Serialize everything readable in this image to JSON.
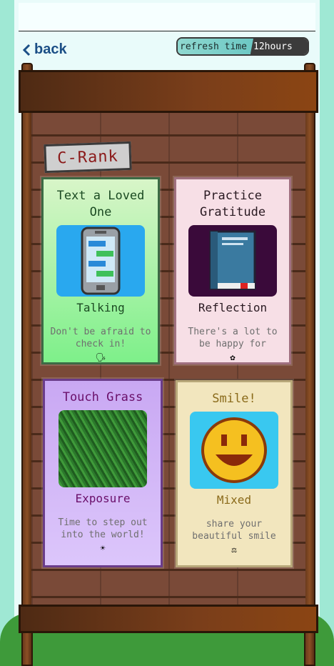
{
  "header": {
    "back_label": "back",
    "refresh_label": "refresh time",
    "refresh_value": "12hours"
  },
  "rank_label": "C-Rank",
  "cards": [
    {
      "title": "Text a Loved One",
      "category": "Talking",
      "description": "Don't be afraid to check in!",
      "icon": "speaking-icon",
      "art": "phone-chat-icon"
    },
    {
      "title": "Practice Gratitude",
      "category": "Reflection",
      "description": "There's a lot to be happy for",
      "icon": "flower-icon",
      "art": "book-icon"
    },
    {
      "title": "Touch Grass",
      "category": "Exposure",
      "description": "Time to step out into the world!",
      "icon": "sun-icon",
      "art": "grass-image"
    },
    {
      "title": "Smile!",
      "category": "Mixed",
      "description": "share your beautiful smile",
      "icon": "scales-icon",
      "art": "smiley-face-icon"
    }
  ],
  "colors": {
    "accent": "#1b4f86",
    "rank_text": "#8b1a1a",
    "grass": "#3e9a3a"
  }
}
